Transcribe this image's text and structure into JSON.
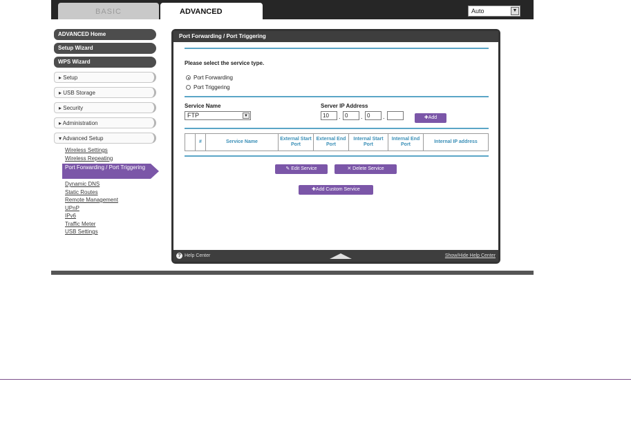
{
  "tabs": {
    "basic": "BASIC",
    "advanced": "ADVANCED"
  },
  "language": {
    "selected": "Auto"
  },
  "nav": {
    "main_items": [
      "ADVANCED Home",
      "Setup Wizard",
      "WPS Wizard"
    ],
    "sections": [
      "▸ Setup",
      "▸ USB Storage",
      "▸ Security",
      "▸ Administration",
      "▾ Advanced Setup"
    ],
    "advanced_items": [
      "Wireless Settings",
      "Wireless Repeating",
      "Port Forwarding / Port Triggering",
      "Dynamic DNS",
      "Static Routes",
      "Remote Management",
      "UPnP",
      "IPv6",
      "Traffic Meter",
      "USB Settings"
    ]
  },
  "panel": {
    "title": "Port Forwarding / Port Triggering",
    "prompt": "Please select the service type.",
    "radio_forwarding": "Port Forwarding",
    "radio_triggering": "Port Triggering",
    "service_name_label": "Service Name",
    "service_name_value": "FTP",
    "server_ip_label": "Server IP Address",
    "ip": [
      "10",
      "0",
      "0",
      ""
    ],
    "add_button": "✚Add",
    "table_headers": [
      "",
      "#",
      "Service Name",
      "External Start Port",
      "External End Port",
      "Internal Start Port",
      "Internal End Port",
      "Internal IP address"
    ],
    "edit_button": "✎ Edit Service",
    "delete_button": "✕ Delete Service",
    "custom_button": "✚Add Custom Service"
  },
  "footer": {
    "help": "Help Center",
    "toggle": "Show/Hide Help Center"
  },
  "colors": {
    "accent": "#7b56a8",
    "rule": "#5aa5c6",
    "header_text": "#3a8fb7"
  }
}
